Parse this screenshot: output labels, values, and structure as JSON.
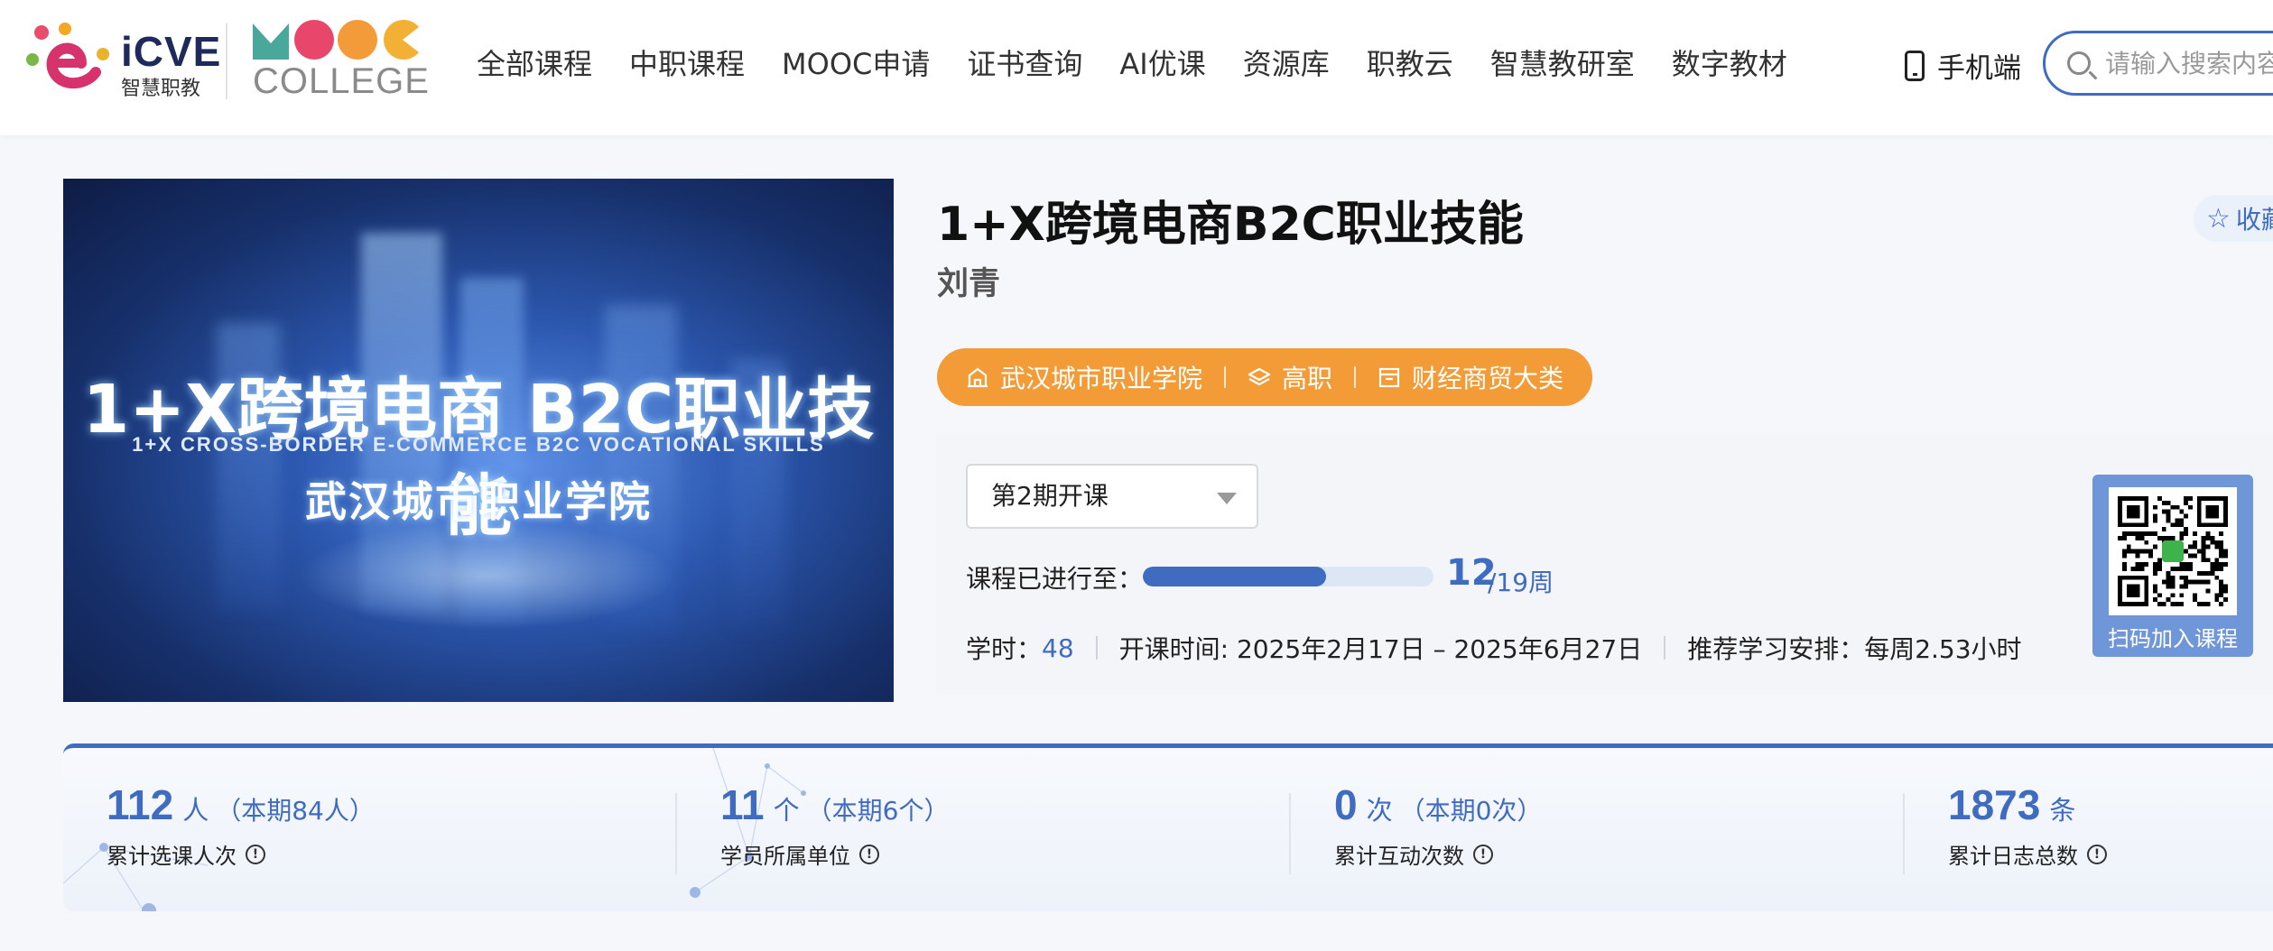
{
  "header": {
    "logo_brand": "iCVE",
    "logo_sub": "智慧职教",
    "mooc_logo_text": "MOOC",
    "mooc_college": "COLLEGE",
    "nav": [
      {
        "label": "全部课程"
      },
      {
        "label": "中职课程"
      },
      {
        "label": "MOOC申请"
      },
      {
        "label": "证书查询"
      },
      {
        "label": "AI优课"
      },
      {
        "label": "资源库"
      },
      {
        "label": "职教云"
      },
      {
        "label": "智慧教研室"
      },
      {
        "label": "数字教材"
      }
    ],
    "mobile_label": "手机端",
    "search_placeholder": "请输入搜索内容",
    "icons": {
      "mobile": "phone-icon",
      "search": "search-icon"
    }
  },
  "course": {
    "cover": {
      "title": "1+X跨境电商 B2C职业技能",
      "subtitle_en": "1+X CROSS-BORDER E-COMMERCE B2C VOCATIONAL SKILLS",
      "school": "武汉城市职业学院"
    },
    "title": "1+X跨境电商B2C职业技能",
    "teacher": "刘青",
    "favorite_label": "收藏",
    "tags": [
      {
        "label": "武汉城市职业学院",
        "icon": "school-icon"
      },
      {
        "label": "高职",
        "icon": "layers-icon"
      },
      {
        "label": "财经商贸大类",
        "icon": "category-icon"
      }
    ],
    "term_select": "第2期开课",
    "progress_label": "课程已进行至：",
    "progress_current": "12",
    "progress_total": "/19周",
    "progress_fraction": 0.6316,
    "hours_label": "学时：",
    "hours_value": "48",
    "dates": "开课时间: 2025年2月17日 – 2025年6月27日",
    "schedule": "推荐学习安排：每周2.53小时",
    "qr_label": "扫码加入课程"
  },
  "stats": [
    {
      "num": "112",
      "unit": "人",
      "period": "（本期84人）",
      "label": "累计选课人次"
    },
    {
      "num": "11",
      "unit": "个",
      "period": "（本期6个）",
      "label": "学员所属单位"
    },
    {
      "num": "0",
      "unit": "次",
      "period": "（本期0次）",
      "label": "累计互动次数"
    },
    {
      "num": "1873",
      "unit": "条",
      "period": "",
      "label": "累计日志总数"
    }
  ],
  "colors": {
    "accent": "#3f6cc0",
    "tag_bg": "#f39c37",
    "info_bg": "#f3f5f8"
  }
}
